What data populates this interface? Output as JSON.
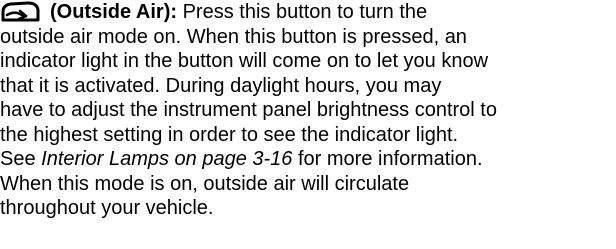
{
  "paragraph": {
    "icon": "outside-air-icon",
    "heading": "(Outside Air):",
    "line1_rest": " Press this button to turn the",
    "line2": "outside air mode on. When this button is pressed, an",
    "line3": "indicator light in the button will come on to let you know",
    "line4": "that it is activated. During daylight hours, you may",
    "line5": "have to adjust the instrument panel brightness control to",
    "line6": "the highest setting in order to see the indicator light.",
    "line7_before": "See ",
    "line7_ref": "Interior Lamps on page 3-16",
    "line7_after": " for more information.",
    "line8": "When this mode is on, outside air will circulate",
    "line9": "throughout your vehicle."
  }
}
